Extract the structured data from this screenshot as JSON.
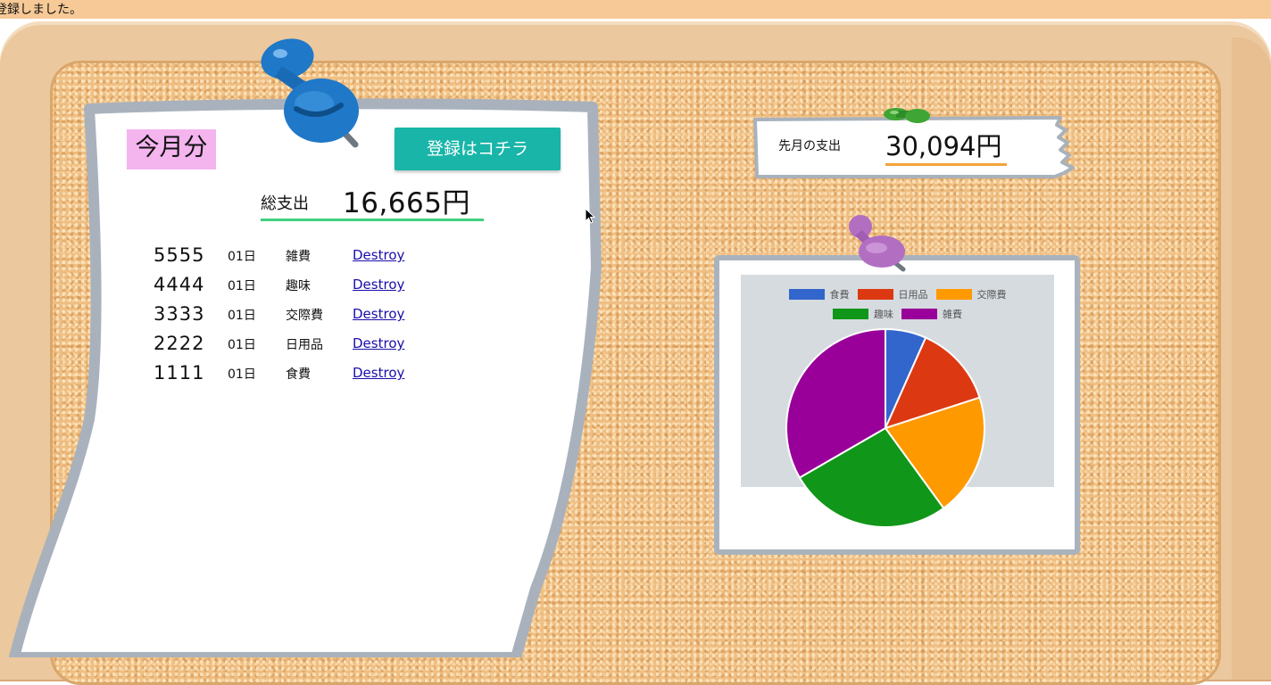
{
  "flash_message": "登録しました。",
  "current_month": {
    "title": "今月分",
    "register_button": "登録はコチラ",
    "total_label": "総支出",
    "total_value": "16,665円",
    "expenses": [
      {
        "amount": "5555",
        "day": "01日",
        "category": "雑費",
        "action": "Destroy"
      },
      {
        "amount": "4444",
        "day": "01日",
        "category": "趣味",
        "action": "Destroy"
      },
      {
        "amount": "3333",
        "day": "01日",
        "category": "交際費",
        "action": "Destroy"
      },
      {
        "amount": "2222",
        "day": "01日",
        "category": "日用品",
        "action": "Destroy"
      },
      {
        "amount": "1111",
        "day": "01日",
        "category": "食費",
        "action": "Destroy"
      }
    ]
  },
  "last_month": {
    "label": "先月の支出",
    "value": "30,094円"
  },
  "chart_data": {
    "type": "pie",
    "categories": [
      "食費",
      "日用品",
      "交際費",
      "趣味",
      "雑費"
    ],
    "values": [
      1111,
      2222,
      3333,
      4444,
      5555
    ],
    "colors": [
      "#3366cc",
      "#dc3912",
      "#ff9900",
      "#109618",
      "#990099"
    ],
    "legend_position": "top"
  },
  "colors": {
    "register_button": "#18b5a8",
    "total_underline": "#3fd07f",
    "last_month_underline": "#f3a33a",
    "title_highlight": "#f4b4ee",
    "flash_bar": "#f6c997"
  }
}
